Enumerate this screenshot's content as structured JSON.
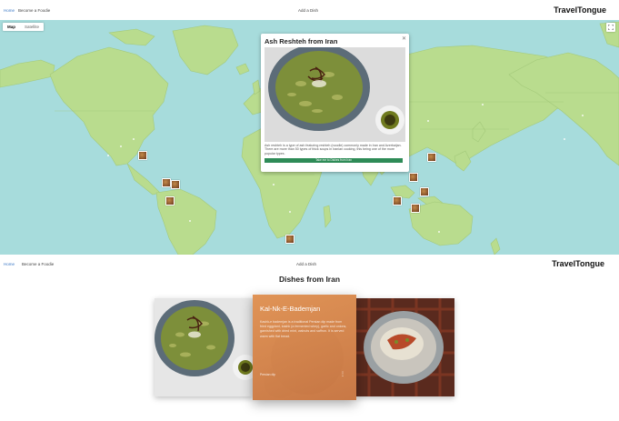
{
  "nav": {
    "home": "Home",
    "become_foodie": "Become a Foodie",
    "add_dish": "Add a Dish",
    "brand": "TravelTongue"
  },
  "map": {
    "type_options": [
      "Map",
      "Satellite"
    ],
    "selected_type": "Map",
    "info_window": {
      "title": "Ash Reshteh from Iran",
      "description": "Ash reshteh is a type of ash featuring reshteh (noodle) commonly made in Iran and Azerbaijan. There are more than 50 types of thick soups in Iranian cooking, this being one of the more popular types.",
      "button": "Take me to Dishes from Iran"
    },
    "colors": {
      "water": "#a7dcdc",
      "land": "#b9dc8e"
    },
    "icons": {
      "fullscreen": "fullscreen-icon",
      "close": "close-icon"
    }
  },
  "dishes": {
    "heading": "Dishes from Iran",
    "featured": {
      "title": "Kal-Nk-E-Bademjan",
      "text": "Kashk-e bademjan is a traditional Persian dip made from fried eggplant, kashk (a fermented whey), garlic and onions, garnished with dried mint, walnuts and saffron. It is served warm with flat bread.",
      "footer": "Persian dip"
    }
  }
}
